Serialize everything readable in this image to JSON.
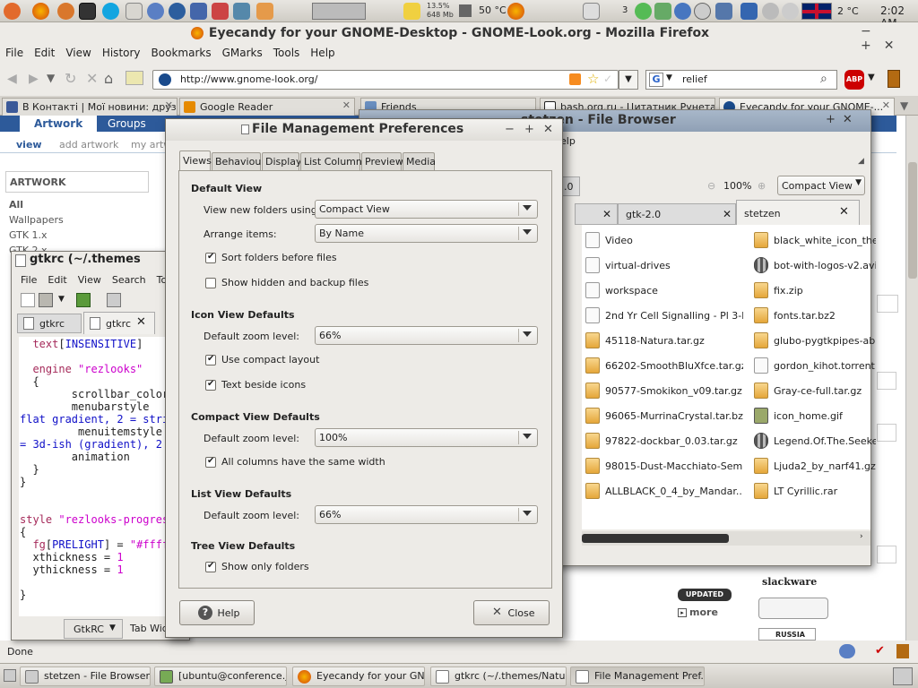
{
  "top_panel": {
    "cpu_mem": "13.5%\n648 Mb",
    "temp_cpu": "50 °C",
    "notif_count": "3",
    "weather": "2 °C",
    "clock": "2:02 AM"
  },
  "firefox": {
    "title": "Eyecandy for your GNOME-Desktop - GNOME-Look.org - Mozilla Firefox",
    "menu": [
      "File",
      "Edit",
      "View",
      "History",
      "Bookmarks",
      "GMarks",
      "Tools",
      "Help"
    ],
    "url": "http://www.gnome-look.org/",
    "search_value": "relief",
    "tabs": [
      {
        "label": "В Контакті | Мої новини: друзі",
        "color": "#3b5998"
      },
      {
        "label": "Google Reader",
        "color": "#e68a00"
      },
      {
        "label": "Friends",
        "color": "#6a8fc0"
      },
      {
        "label": "bash.org.ru - Цитатник Рунета",
        "color": "#222"
      },
      {
        "label": "Eyecandy for your GNOME-...",
        "color": "#1a4b8c"
      }
    ],
    "page": {
      "top_tabs": [
        "Artwork",
        "Groups"
      ],
      "sub_nav": [
        "view",
        "add artwork",
        "my artwork"
      ],
      "sidebar_heading": "ARTWORK",
      "sidebar_items": [
        "All",
        "Wallpapers",
        "GTK 1.x",
        "GTK 2.x"
      ],
      "more": "more",
      "updated_badge": "UPDATED",
      "slackware": "slackware",
      "russia": "RUSSIA"
    },
    "status": "Done"
  },
  "gtkrc": {
    "title": "gtkrc (~/.themes",
    "menu": [
      "File",
      "Edit",
      "View",
      "Search",
      "To"
    ],
    "tabs": [
      "gtkrc",
      "gtkrc"
    ],
    "bottom_combo": "GtkRC",
    "bottom_tab": "Tab Wid"
  },
  "file_browser": {
    "title": "stetzen - File Browser",
    "zoom": "100%",
    "view_mode": "Compact View",
    "path_fragment": "2.0",
    "tabs": [
      "gtk-2.0",
      "stetzen"
    ],
    "files_col1": [
      {
        "name": "Video",
        "icon": "folder"
      },
      {
        "name": "virtual-drives",
        "icon": "folder"
      },
      {
        "name": "workspace",
        "icon": "folder"
      },
      {
        "name": "2nd Yr Cell Signalling - Pl 3-k...",
        "icon": "doc"
      },
      {
        "name": "45118-Natura.tar.gz",
        "icon": "archive"
      },
      {
        "name": "66202-SmoothBluXfce.tar.gz",
        "icon": "archive"
      },
      {
        "name": "90577-Smokikon_v09.tar.gz",
        "icon": "archive"
      },
      {
        "name": "96065-MurrinaCrystal.tar.bz2",
        "icon": "archive"
      },
      {
        "name": "97822-dockbar_0.03.tar.gz",
        "icon": "archive"
      },
      {
        "name": "98015-Dust-Macchiato-Semi...",
        "icon": "archive"
      },
      {
        "name": "ALLBLACK_0_4_by_Mandar...",
        "icon": "archive"
      }
    ],
    "files_col2": [
      {
        "name": "black_white_icon_ther",
        "icon": "archive"
      },
      {
        "name": "bot-with-logos-v2.avi",
        "icon": "film"
      },
      {
        "name": "fix.zip",
        "icon": "archive"
      },
      {
        "name": "fonts.tar.bz2",
        "icon": "archive"
      },
      {
        "name": "glubo-pygtkpipes-ab6",
        "icon": "archive"
      },
      {
        "name": "gordon_kihot.torrent",
        "icon": "doc"
      },
      {
        "name": "Gray-ce-full.tar.gz",
        "icon": "archive"
      },
      {
        "name": "icon_home.gif",
        "icon": "image"
      },
      {
        "name": "Legend.Of.The.Seeke",
        "icon": "film"
      },
      {
        "name": "Ljuda2_by_narf41.gz",
        "icon": "archive"
      },
      {
        "name": "LT Cyrillic.rar",
        "icon": "archive"
      }
    ],
    "menu_fragment": "elp"
  },
  "prefs": {
    "title": "File Management Preferences",
    "tabs": [
      "Views",
      "Behaviour",
      "Display",
      "List Columns",
      "Preview",
      "Media"
    ],
    "default_view": {
      "heading": "Default View",
      "view_new_label": "View new folders using:",
      "view_new_value": "Compact View",
      "arrange_label": "Arrange items:",
      "arrange_value": "By Name",
      "sort_folders": "Sort folders before files",
      "show_hidden": "Show hidden and backup files"
    },
    "icon_view": {
      "heading": "Icon View Defaults",
      "zoom_label": "Default zoom level:",
      "zoom_value": "66%",
      "compact_layout": "Use compact layout",
      "text_beside": "Text beside icons"
    },
    "compact_view": {
      "heading": "Compact View Defaults",
      "zoom_label": "Default zoom level:",
      "zoom_value": "100%",
      "same_width": "All columns have the same width"
    },
    "list_view": {
      "heading": "List View Defaults",
      "zoom_label": "Default zoom level:",
      "zoom_value": "66%"
    },
    "tree_view": {
      "heading": "Tree View Defaults",
      "only_folders": "Show only folders"
    },
    "help_button": "Help",
    "close_button": "Close"
  },
  "taskbar": [
    "stetzen - File Browser",
    "[ubuntu@conference.j...",
    "Eyecandy for your GN...",
    "gtkrc (~/.themes/Natur...",
    "File Management Pref..."
  ]
}
